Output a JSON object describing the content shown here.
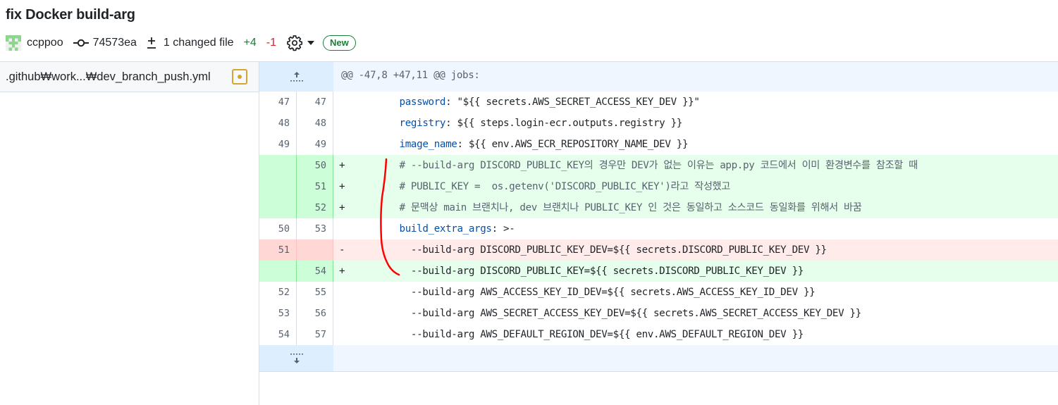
{
  "commit": {
    "title": "fix Docker build-arg",
    "author": "ccppoo",
    "hash": "74573ea",
    "changed_files": "1 changed file",
    "additions": "+4",
    "deletions": "-1",
    "badge": "New"
  },
  "sidebar": {
    "files": [
      {
        "name": ".github₩work...₩dev_branch_push.yml",
        "status": "modified",
        "status_color": "#d4a72c"
      }
    ]
  },
  "diff": {
    "hunk_header": "@@ -47,8 +47,11 @@ jobs:",
    "lines": [
      {
        "type": "ctx",
        "old": "47",
        "new": "47",
        "sign": "",
        "indent": "        ",
        "key": "password",
        "rest": ": \"${{ secrets.AWS_SECRET_ACCESS_KEY_DEV }}\""
      },
      {
        "type": "ctx",
        "old": "48",
        "new": "48",
        "sign": "",
        "indent": "        ",
        "key": "registry",
        "rest": ": ${{ steps.login-ecr.outputs.registry }}"
      },
      {
        "type": "ctx",
        "old": "49",
        "new": "49",
        "sign": "",
        "indent": "        ",
        "key": "image_name",
        "rest": ": ${{ env.AWS_ECR_REPOSITORY_NAME_DEV }}"
      },
      {
        "type": "add",
        "old": "",
        "new": "50",
        "sign": "+",
        "indent": "        ",
        "key": "",
        "rest": "# --build-arg DISCORD_PUBLIC_KEY의 경우만 DEV가 없는 이유는 app.py 코드에서 이미 환경변수를 참조할 때"
      },
      {
        "type": "add",
        "old": "",
        "new": "51",
        "sign": "+",
        "indent": "        ",
        "key": "",
        "rest": "# PUBLIC_KEY =  os.getenv('DISCORD_PUBLIC_KEY')라고 작성했고"
      },
      {
        "type": "add",
        "old": "",
        "new": "52",
        "sign": "+",
        "indent": "        ",
        "key": "",
        "rest": "# 문맥상 main 브랜치나, dev 브랜치나 PUBLIC_KEY 인 것은 동일하고 소스코드 동일화를 위해서 바꿈"
      },
      {
        "type": "ctx",
        "old": "50",
        "new": "53",
        "sign": "",
        "indent": "        ",
        "key": "build_extra_args",
        "rest": ": >-"
      },
      {
        "type": "del",
        "old": "51",
        "new": "",
        "sign": "-",
        "indent": "          ",
        "key": "",
        "rest": "--build-arg DISCORD_PUBLIC_KEY_DEV=${{ secrets.DISCORD_PUBLIC_KEY_DEV }}"
      },
      {
        "type": "add",
        "old": "",
        "new": "54",
        "sign": "+",
        "indent": "          ",
        "key": "",
        "rest": "--build-arg DISCORD_PUBLIC_KEY=${{ secrets.DISCORD_PUBLIC_KEY_DEV }}"
      },
      {
        "type": "ctx",
        "old": "52",
        "new": "55",
        "sign": "",
        "indent": "          ",
        "key": "",
        "rest": "--build-arg AWS_ACCESS_KEY_ID_DEV=${{ secrets.AWS_ACCESS_KEY_ID_DEV }}"
      },
      {
        "type": "ctx",
        "old": "53",
        "new": "56",
        "sign": "",
        "indent": "          ",
        "key": "",
        "rest": "--build-arg AWS_SECRET_ACCESS_KEY_DEV=${{ secrets.AWS_SECRET_ACCESS_KEY_DEV }}"
      },
      {
        "type": "ctx",
        "old": "54",
        "new": "57",
        "sign": "",
        "indent": "          ",
        "key": "",
        "rest": "--build-arg AWS_DEFAULT_REGION_DEV=${{ env.AWS_DEFAULT_REGION_DEV }}"
      }
    ]
  },
  "icons": {
    "avatar": "identicon-avatar",
    "commit": "git-commit-icon",
    "diff": "diff-icon",
    "settings": "gear-icon",
    "dropdown": "caret-down-icon",
    "expand_up": "expand-up-icon",
    "expand_down": "expand-down-icon",
    "file_status": "file-modified-icon"
  },
  "colors": {
    "addition": "#1a7f37",
    "deletion": "#d1242f",
    "annotation": "#ff0000"
  }
}
